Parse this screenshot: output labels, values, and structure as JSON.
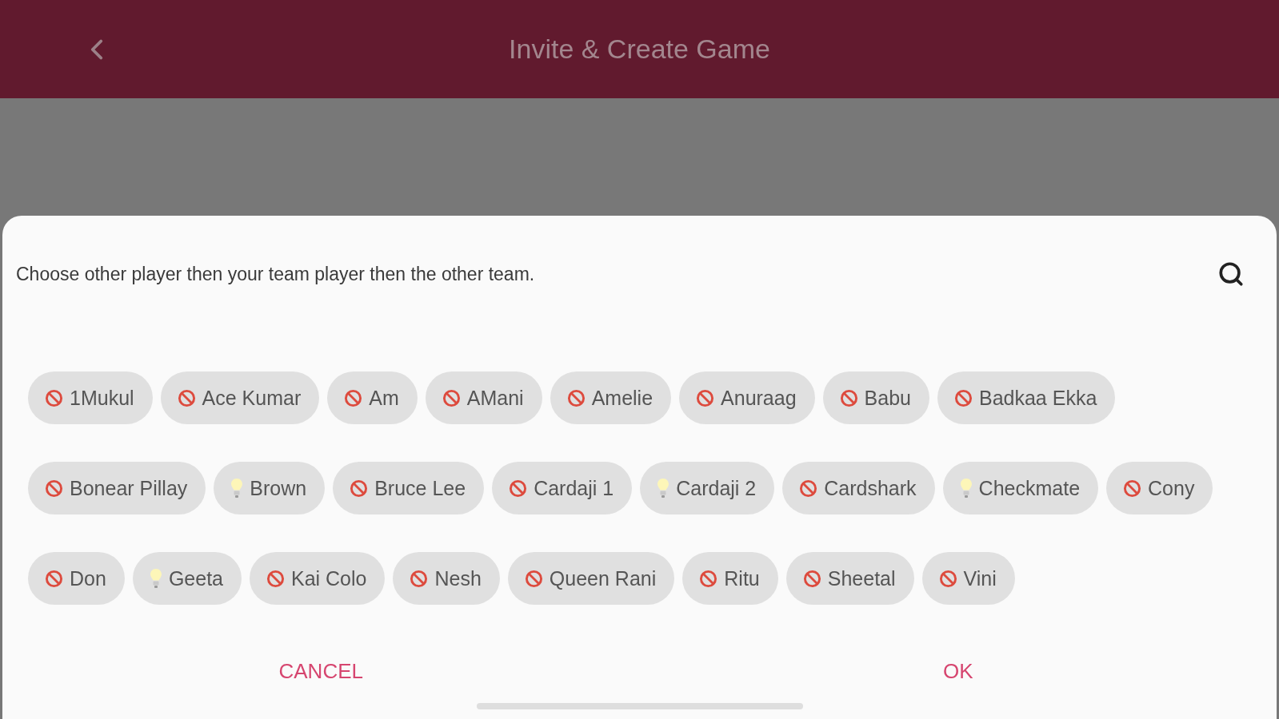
{
  "header": {
    "title": "Invite & Create Game"
  },
  "dialog": {
    "instruction": "Choose other player then your team player then the other team.",
    "players": [
      {
        "name": "1Mukul",
        "kind": "blocked"
      },
      {
        "name": "Ace Kumar",
        "kind": "blocked"
      },
      {
        "name": "Am",
        "kind": "blocked"
      },
      {
        "name": "AMani",
        "kind": "blocked"
      },
      {
        "name": "Amelie",
        "kind": "blocked"
      },
      {
        "name": "Anuraag",
        "kind": "blocked"
      },
      {
        "name": "Babu",
        "kind": "blocked"
      },
      {
        "name": "Badkaa Ekka",
        "kind": "blocked"
      },
      {
        "name": "Bonear Pillay",
        "kind": "blocked"
      },
      {
        "name": "Brown",
        "kind": "bulb"
      },
      {
        "name": "Bruce Lee",
        "kind": "blocked"
      },
      {
        "name": "Cardaji 1",
        "kind": "blocked"
      },
      {
        "name": "Cardaji 2",
        "kind": "bulb"
      },
      {
        "name": "Cardshark",
        "kind": "blocked"
      },
      {
        "name": "Checkmate",
        "kind": "bulb"
      },
      {
        "name": "Cony",
        "kind": "blocked"
      },
      {
        "name": "Don",
        "kind": "blocked"
      },
      {
        "name": "Geeta",
        "kind": "bulb"
      },
      {
        "name": "Kai Colo",
        "kind": "blocked"
      },
      {
        "name": "Nesh",
        "kind": "blocked"
      },
      {
        "name": "Queen Rani",
        "kind": "blocked"
      },
      {
        "name": "Ritu",
        "kind": "blocked"
      },
      {
        "name": "Sheetal",
        "kind": "blocked"
      },
      {
        "name": "Vini",
        "kind": "blocked"
      }
    ],
    "buttons": [
      "CANCEL",
      "OK"
    ]
  }
}
